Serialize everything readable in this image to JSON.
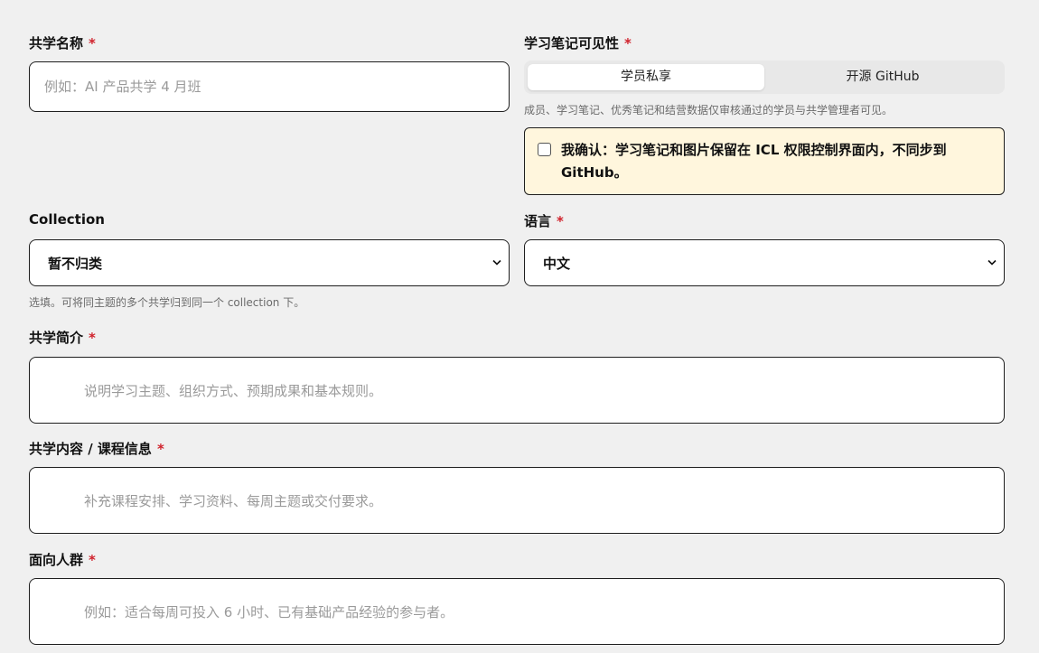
{
  "form": {
    "name": {
      "label": "共学名称",
      "required_mark": "*",
      "placeholder": "例如：AI 产品共学 4 月班"
    },
    "visibility": {
      "label": "学习笔记可见性",
      "required_mark": "*",
      "options": [
        "学员私享",
        "开源 GitHub"
      ],
      "selected": "学员私享",
      "help": "成员、学习笔记、优秀笔记和结营数据仅审核通过的学员与共学管理者可见。",
      "confirm_text": "我确认：学习笔记和图片保留在 ICL 权限控制界面内，不同步到 GitHub。",
      "confirm_checked": false
    },
    "collection": {
      "label": "Collection",
      "selected": "暂不归类",
      "help": "选填。可将同主题的多个共学归到同一个 collection 下。"
    },
    "language": {
      "label": "语言",
      "required_mark": "*",
      "selected": "中文"
    },
    "intro": {
      "label": "共学简介",
      "required_mark": "*",
      "placeholder": "说明学习主题、组织方式、预期成果和基本规则。"
    },
    "content": {
      "label": "共学内容 / 课程信息",
      "required_mark": "*",
      "placeholder": "补充课程安排、学习资料、每周主题或交付要求。"
    },
    "audience": {
      "label": "面向人群",
      "required_mark": "*",
      "placeholder": "例如：适合每周可投入 6 小时、已有基础产品经验的参与者。"
    }
  },
  "colors": {
    "background": "#f0f0f0",
    "required": "#d0212b",
    "notice_bg": "#fff6dd",
    "border": "#1e1e1e"
  },
  "icons": {
    "select_indicator": "chevron-down-icon"
  }
}
